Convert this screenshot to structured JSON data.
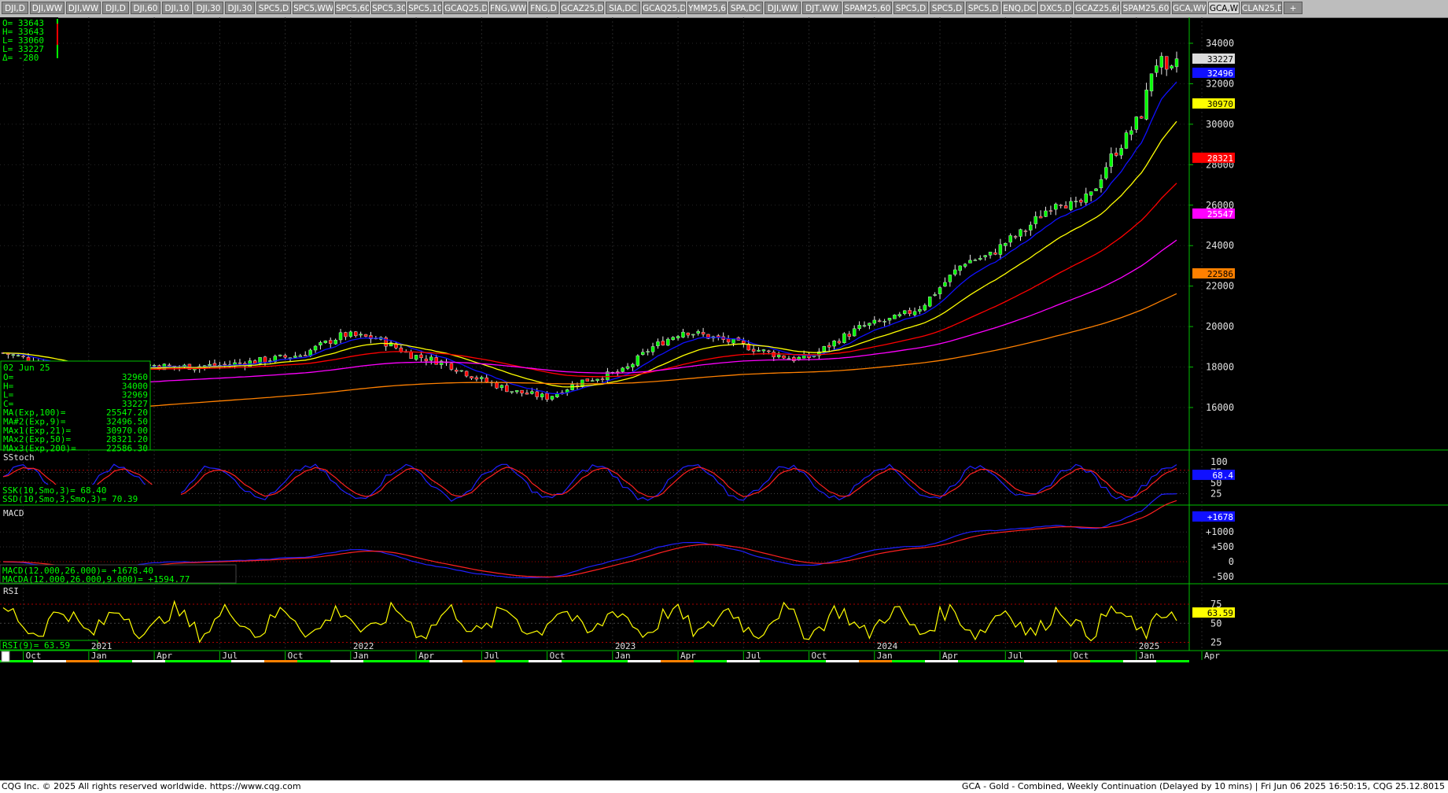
{
  "tabs": [
    "DJI,D",
    "DJI,WW",
    "DJI,WW",
    "DJI,D",
    "DJI,60",
    "DJI,10",
    "DJI,30",
    "DJI,30",
    "SPC5,D",
    "SPC5,WW",
    "SPC5,60",
    "SPC5,30",
    "SPC5,10",
    "GCAQ25,D",
    "FNG,WW",
    "FNG,D",
    "GCAZ25,D",
    "SIA,DC",
    "GCAQ25,D",
    "YMM25,60",
    "SPA,DC",
    "DJI,WW",
    "DJT,WW",
    "SPAM25,60",
    "SPC5,D",
    "SPC5,D",
    "SPC5,D",
    "ENQ,DC",
    "DXC5,D",
    "GCAZ25,60",
    "SPAM25,60",
    "GCA,WW",
    "GCA,W",
    "CLAN25,D",
    "+"
  ],
  "active_tab": "GCA,W",
  "ohlc_box": {
    "o": "O=   33643",
    "h": "H=   33643",
    "l1": "L=   33060",
    "l2": "L=   33227",
    "d": "Δ=    -280"
  },
  "data_box": {
    "date": "02 Jun 25",
    "rows": [
      {
        "label": "O=",
        "value": "32960"
      },
      {
        "label": "H=",
        "value": "34000"
      },
      {
        "label": "L=",
        "value": "32969"
      },
      {
        "label": "C=",
        "value": "33227"
      },
      {
        "label": "MA(Exp,100)=",
        "value": "25547.20"
      },
      {
        "label": "MA#2(Exp,9)=",
        "value": "32496.50"
      },
      {
        "label": "MAx1(Exp,21)=",
        "value": "30970.00"
      },
      {
        "label": "MAx2(Exp,50)=",
        "value": "28321.20"
      },
      {
        "label": "MAx3(Exp,200)=",
        "value": "22586.30"
      }
    ]
  },
  "price_axis": {
    "ticks": [
      "34000",
      "32000",
      "30000",
      "28000",
      "26000",
      "24000",
      "22000",
      "20000",
      "18000",
      "16000"
    ]
  },
  "price_labels": [
    {
      "text": "33227",
      "color": "#dcdcdc",
      "text_color": "#000000"
    },
    {
      "text": "32496",
      "color": "#1010ff",
      "text_color": "#ffffff"
    },
    {
      "text": "30970",
      "color": "#ffff00",
      "text_color": "#000000"
    },
    {
      "text": "28321",
      "color": "#ff0000",
      "text_color": "#ffffff"
    },
    {
      "text": "25547",
      "color": "#ff00ff",
      "text_color": "#ffffff"
    },
    {
      "text": "22586",
      "color": "#ff8000",
      "text_color": "#000000"
    }
  ],
  "sstoch": {
    "title": "SStoch",
    "ssk": "SSK(10,Smo,3)=       68.40",
    "ssd": "SSD(10,Smo,3,Smo,3)=   70.39",
    "current": "68.4",
    "ticks": [
      "100",
      "75",
      "50",
      "25"
    ]
  },
  "macd": {
    "title": "MACD",
    "macd_line": "MACD(12.000,26.000)=    +1678.40",
    "macda_line": "MACDA(12.000,26.000,9.000)= +1594.77",
    "current": "+1678",
    "ticks": [
      "+1000",
      "+500",
      "0",
      "-500"
    ]
  },
  "rsi": {
    "title": "RSI",
    "line": "RSI(9)=    63.59",
    "current": "63.59",
    "ticks": [
      "75",
      "50",
      "25"
    ]
  },
  "time_axis": [
    "Oct",
    "Jan",
    "Apr",
    "Jul",
    "Oct",
    "Jan",
    "Apr",
    "Jul",
    "Oct",
    "Jan",
    "Apr",
    "Jul",
    "Oct",
    "Jan",
    "Apr",
    "Jul",
    "Oct",
    "Jan",
    "Apr"
  ],
  "years": [
    "2021",
    "2022",
    "2023",
    "2024",
    "2025"
  ],
  "colors": {
    "up": "#00ff00",
    "down": "#ff0000",
    "ma9": "#1010ff",
    "ma21": "#ffff00",
    "ma50": "#ff0000",
    "ma100": "#ff00ff",
    "ma200": "#ff8000",
    "axis": "#00ff00",
    "grid": "#222222"
  },
  "footer": {
    "left": "CQG Inc. © 2025 All rights reserved worldwide. https://www.cqg.com",
    "right": "GCA - Gold - Combined, Weekly Continuation (Delayed by 10 mins) | Fri Jun 06 2025 16:50:15, CQG 25.12.8015"
  }
}
